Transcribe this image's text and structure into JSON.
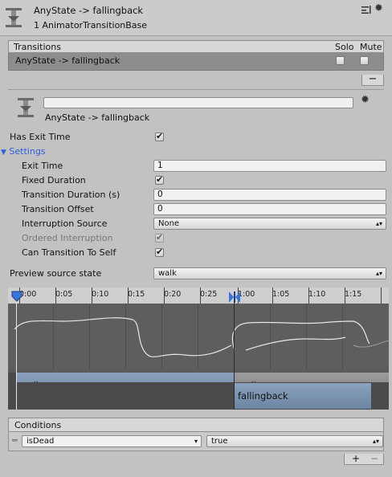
{
  "header": {
    "title": "AnyState -> fallingback",
    "subtitle": "1 AnimatorTransitionBase",
    "icon": "transition-icon"
  },
  "transitions": {
    "header_label": "Transitions",
    "solo_label": "Solo",
    "mute_label": "Mute",
    "rows": [
      {
        "label": "AnyState -> fallingback",
        "solo": false,
        "mute": false
      }
    ],
    "remove_label": "−"
  },
  "transition_panel": {
    "name_value": "",
    "subtitle": "AnyState -> fallingback",
    "icon": "transition-icon"
  },
  "has_exit_time": {
    "label": "Has Exit Time",
    "checked": true
  },
  "settings": {
    "label": "Settings",
    "exit_time": {
      "label": "Exit Time",
      "value": "1"
    },
    "fixed_duration": {
      "label": "Fixed Duration",
      "checked": true
    },
    "transition_duration": {
      "label": "Transition Duration (s)",
      "value": "0"
    },
    "transition_offset": {
      "label": "Transition Offset",
      "value": "0"
    },
    "interruption_source": {
      "label": "Interruption Source",
      "value": "None"
    },
    "ordered_interruption": {
      "label": "Ordered Interruption",
      "checked": true,
      "disabled": true
    },
    "can_transition_to_self": {
      "label": "Can Transition To Self",
      "checked": true
    }
  },
  "preview": {
    "label": "Preview source state",
    "value": "walk"
  },
  "timeline": {
    "ticks": [
      "0:00",
      "0:05",
      "0:10",
      "0:15",
      "0:20",
      "0:25",
      "1:00",
      "1:05",
      "1:10",
      "1:15"
    ],
    "clips_row1": [
      "walk",
      "walk"
    ],
    "clips_row2": [
      "fallingback"
    ]
  },
  "conditions": {
    "header_label": "Conditions",
    "rows": [
      {
        "parameter": "isDead",
        "value": "true"
      }
    ],
    "add_label": "+",
    "remove_label": "−"
  },
  "colors": {
    "panel": "#c2c2c2",
    "selected_row": "#8d8d8d",
    "settings_accent": "#2e5fd6",
    "clip_blue": "#7d96b4",
    "timeline_bg": "#5e5e5e"
  }
}
